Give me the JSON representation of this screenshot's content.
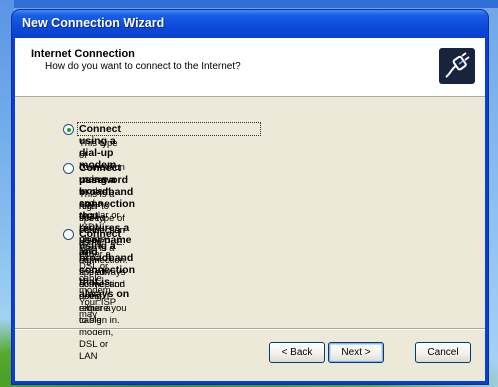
{
  "window": {
    "title": "New Connection Wizard"
  },
  "header": {
    "title": "Internet Connection",
    "subtitle": "How do you want to connect to the Internet?",
    "icon": "connection-plug-icon"
  },
  "options": [
    {
      "label": "Connect using a dial-up modem",
      "description_lines": [
        "This type of connection uses a modem and a regular or ISDN phone line."
      ],
      "selected": true
    },
    {
      "label_lines": [
        "Connect using a broadband connection that requires a user name and",
        "password"
      ],
      "description_lines": [
        "This is a high-speed connection using either a DSL or cable modem. Your ISP may",
        "refer to this type of connection as PPPoE."
      ],
      "selected": false
    },
    {
      "label": "Connect using a broadband connection that is always on",
      "description_lines": [
        "This is a high-speed connection using either a cable modem, DSL or LAN",
        "connection. It is always active, and doesn't require you to sign in."
      ],
      "selected": false
    }
  ],
  "buttons": {
    "back": "< Back",
    "next": "Next >",
    "cancel": "Cancel"
  },
  "colors": {
    "titlebar": "#0a3fd2",
    "dialog_bg": "#ece9d8",
    "radio_selected": "#21a121"
  }
}
